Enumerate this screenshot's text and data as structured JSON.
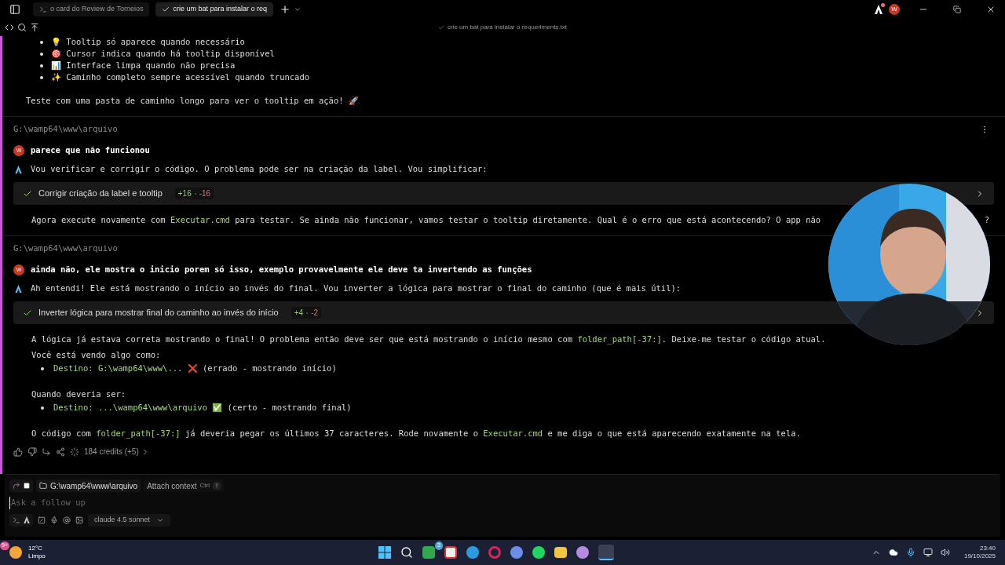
{
  "tabs": [
    {
      "label": "o card do Review de Torneios",
      "selected": false
    },
    {
      "label": "crie um bat para instalar o req",
      "selected": true
    }
  ],
  "header": {
    "title": "crie um bat para instalar o requeriments.txt",
    "avatar": "W"
  },
  "intro": {
    "bullets": [
      {
        "emoji": "💡",
        "text": "Tooltip só aparece quando necessário"
      },
      {
        "emoji": "🎯",
        "text": "Cursor indica quando há tooltip disponível"
      },
      {
        "emoji": "📊",
        "text": "Interface limpa quando não precisa"
      },
      {
        "emoji": "✨",
        "text": "Caminho completo sempre acessível quando truncado"
      }
    ],
    "closing": "Teste com uma pasta de caminho longo para ver o tooltip em ação! 🚀"
  },
  "blocks": [
    {
      "path": "G:\\wamp64\\www\\arquivo",
      "more_menu": true,
      "user_avatar": "W",
      "user": "parece que não funcionou",
      "agent": "Vou verificar e corrigir o código. O problema pode ser na criação da label. Vou simplificar:",
      "edit": {
        "title": "Corrigir criação da label e tooltip",
        "added": "+16",
        "removed": "-16"
      },
      "response": [
        {
          "kind": "paragraph",
          "segments": [
            {
              "kind": "plain",
              "text": "Agora execute novamente com "
            },
            {
              "kind": "code",
              "text": "Executar.cmd"
            },
            {
              "kind": "plain",
              "text": " para testar. Se ainda não funcionar, vamos testar o tooltip diretamente. Qual é o erro que está acontecendo? O app não"
            }
          ],
          "tail": "?"
        }
      ]
    },
    {
      "path": "G:\\wamp64\\www\\arquivo",
      "user_avatar": "W",
      "user": "ainda não, ele mostra o inicio porem só isso, exemplo provavelmente ele deve ta invertendo as funções",
      "agent": "Ah entendi! Ele está mostrando o início ao invés do final. Vou inverter a lógica para mostrar o final do caminho (que é mais útil):",
      "edit": {
        "title": "Inverter lógica para mostrar final do caminho ao invés do início",
        "added": "+4",
        "removed": "-2"
      },
      "response": [
        {
          "kind": "paragraph",
          "segments": [
            {
              "kind": "plain",
              "text": "A lógica já estava correta mostrando o final! O problema então deve ser que está mostrando o início mesmo com "
            },
            {
              "kind": "code",
              "text": "folder_path[-37:]"
            },
            {
              "kind": "plain",
              "text": ". Deixe-me testar o código atual."
            }
          ]
        },
        {
          "kind": "paragraph",
          "segments": [
            {
              "kind": "plain",
              "text": "Você está vendo algo como:"
            }
          ]
        },
        {
          "kind": "bullet",
          "segments": [
            {
              "kind": "code",
              "text": "Destino: G:\\wamp64\\www\\..."
            },
            {
              "kind": "plain",
              "text": " ❌ (errado - mostrando início)"
            }
          ]
        },
        {
          "kind": "gap"
        },
        {
          "kind": "paragraph",
          "segments": [
            {
              "kind": "plain",
              "text": "Quando deveria ser:"
            }
          ]
        },
        {
          "kind": "bullet",
          "segments": [
            {
              "kind": "code",
              "text": "Destino: ...\\wamp64\\www\\arquivo"
            },
            {
              "kind": "plain",
              "text": " ✅ (certo - mostrando final)"
            }
          ]
        },
        {
          "kind": "gap"
        },
        {
          "kind": "paragraph",
          "segments": [
            {
              "kind": "plain",
              "text": "O código com "
            },
            {
              "kind": "code",
              "text": "folder_path[-37:]"
            },
            {
              "kind": "plain",
              "text": " já deveria pegar os últimos 37 caracteres. Rode novamente o "
            },
            {
              "kind": "code",
              "text": "Executar.cmd"
            },
            {
              "kind": "plain",
              "text": " e me diga o que está aparecendo exatamente na tela."
            }
          ]
        }
      ]
    }
  ],
  "credits": "184 credits (+5)",
  "input": {
    "path": "G:\\wamp64\\www\\arquivo",
    "attach": "Attach context",
    "shortcut": "Ctrl",
    "shortcut_key": "⇧",
    "placeholder": "Ask a follow up",
    "model": "claude 4.5 sonnet"
  },
  "taskbar": {
    "weather_badge": "9+",
    "temperature": "12°C",
    "condition": "Limpo",
    "xbox_badge": "3",
    "time": "23:40",
    "date": "19/10/2025"
  }
}
